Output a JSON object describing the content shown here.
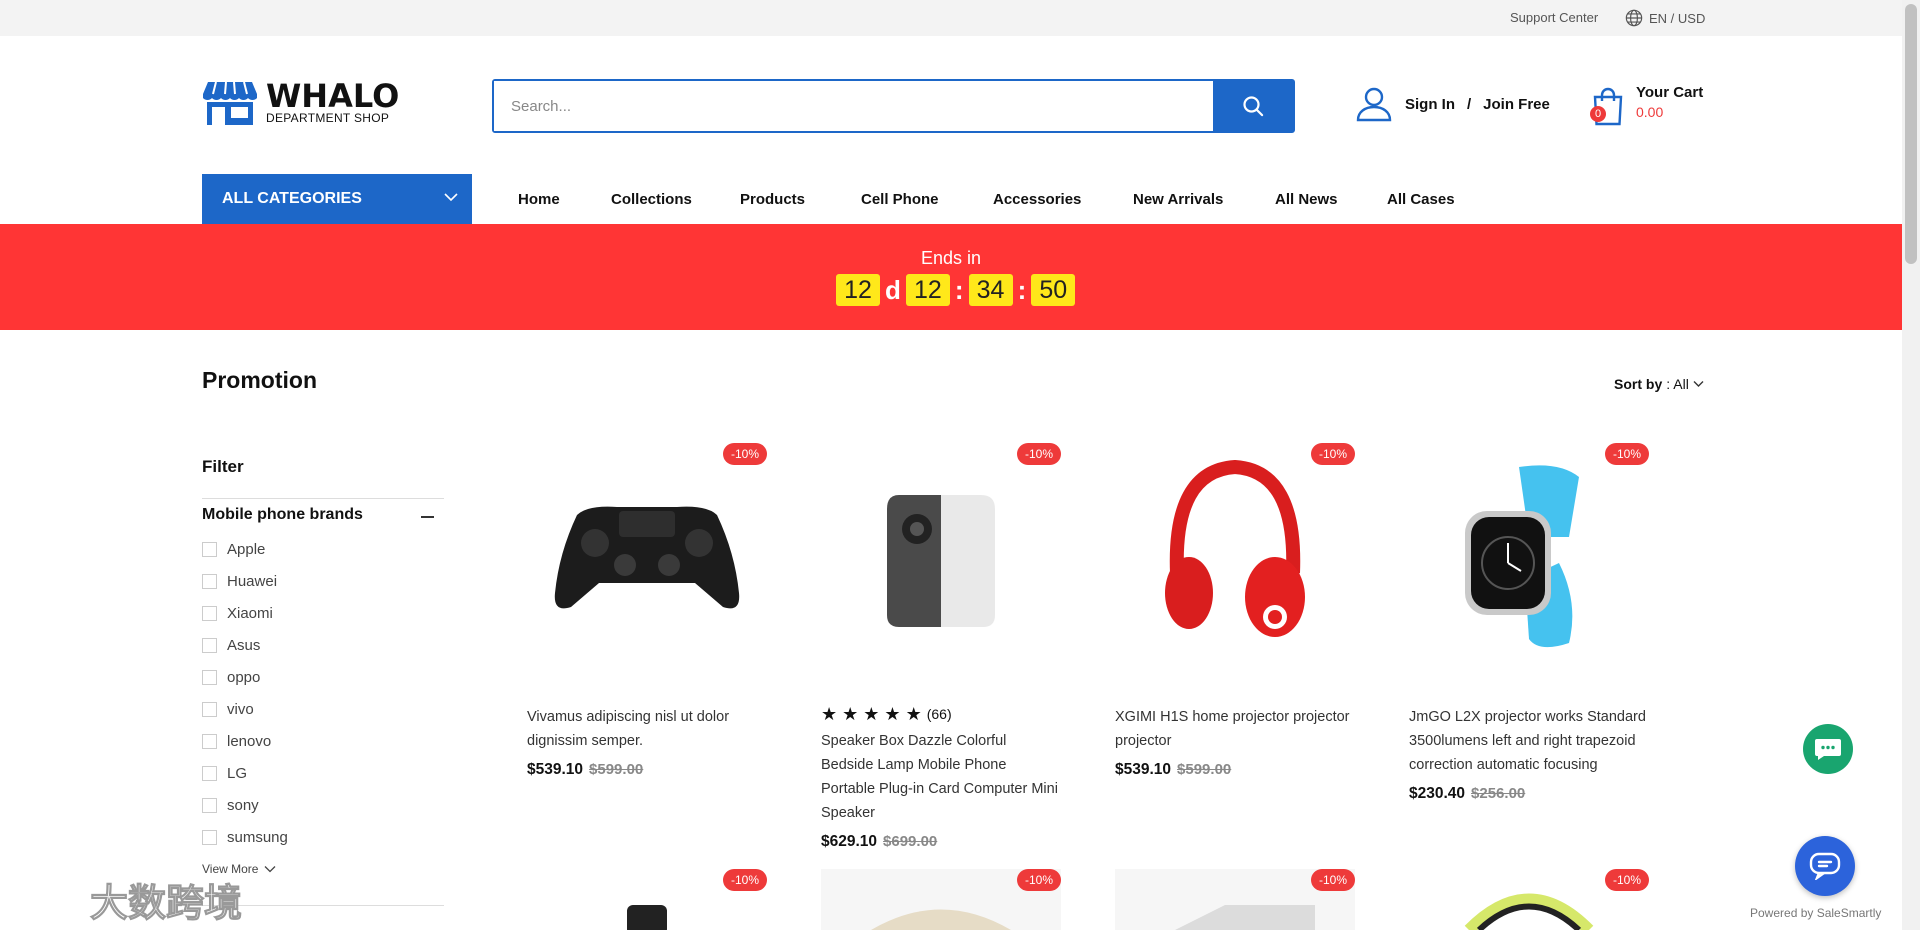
{
  "topbar": {
    "support": "Support Center",
    "lang": "EN / USD"
  },
  "logo": {
    "brand": "WHALO",
    "sub": "DEPARTMENT  SHOP"
  },
  "search": {
    "placeholder": "Search..."
  },
  "account": {
    "signin": "Sign In",
    "sep": "/",
    "join": "Join Free"
  },
  "cart": {
    "label": "Your Cart",
    "total": "0.00",
    "count": "0"
  },
  "categories": {
    "label": "ALL CATEGORIES"
  },
  "nav": [
    "Home",
    "Collections",
    "Products",
    "Cell Phone",
    "Accessories",
    "New Arrivals",
    "All News",
    "All Cases"
  ],
  "countdown": {
    "label": "Ends in",
    "days": "12",
    "day_unit": "d",
    "hours": "12",
    "minutes": "34",
    "seconds": "50"
  },
  "page": {
    "title": "Promotion",
    "sort_label": "Sort by",
    "sort_value": ": All"
  },
  "filter": {
    "title": "Filter",
    "group": "Mobile phone brands",
    "options": [
      "Apple",
      "Huawei",
      "Xiaomi",
      "Asus",
      "oppo",
      "vivo",
      "lenovo",
      "LG",
      "sony",
      "sumsung"
    ],
    "view_more": "View More"
  },
  "products": [
    {
      "badge": "-10%",
      "title": "Vivamus adipiscing nisl ut dolor dignissim semper.",
      "price": "$539.10",
      "old": "$599.00",
      "image": "gamepad"
    },
    {
      "badge": "-10%",
      "title": "Speaker Box Dazzle Colorful Bedside Lamp Mobile Phone Portable Plug-in Card Computer Mini Speaker",
      "price": "$629.10",
      "old": "$699.00",
      "reviews": "(66)",
      "rating": 5,
      "image": "projector"
    },
    {
      "badge": "-10%",
      "title": "XGIMI H1S home projector projector projector",
      "price": "$539.10",
      "old": "$599.00",
      "image": "headphones"
    },
    {
      "badge": "-10%",
      "title": "JmGO L2X projector works Standard 3500lumens left and right trapezoid correction automatic focusing",
      "price": "$230.40",
      "old": "$256.00",
      "image": "smartwatch"
    },
    {
      "badge": "-10%"
    },
    {
      "badge": "-10%"
    },
    {
      "badge": "-10%"
    },
    {
      "badge": "-10%"
    }
  ],
  "widgets": {
    "powered": "Powered by SaleSmartly"
  },
  "watermark": "大数跨境",
  "colors": {
    "primary": "#1d67c8",
    "banner": "#ff3535",
    "sale": "#ee3a3a",
    "timer": "#ffe81a",
    "chat_green": "#19a56f",
    "chat_blue": "#2c63db"
  }
}
